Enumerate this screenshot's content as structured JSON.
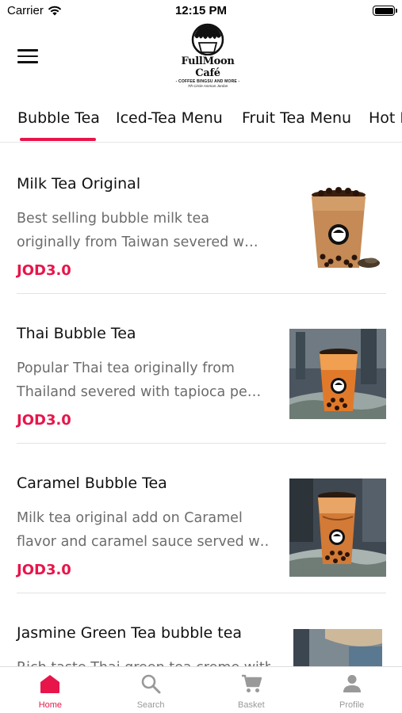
{
  "status_bar": {
    "carrier": "Carrier",
    "time": "12:15 PM"
  },
  "header": {
    "logo_name": "FullMoon Café",
    "logo_tagline": "- COFFEE BINGSU AND MORE -",
    "logo_address": "7th Circle Amman Jordan"
  },
  "tabs": [
    {
      "label": "Bubble Tea",
      "active": true
    },
    {
      "label": "Iced-Tea Menu",
      "active": false
    },
    {
      "label": "Fruit Tea Menu",
      "active": false
    },
    {
      "label": "Hot Dr",
      "active": false
    }
  ],
  "items": [
    {
      "name": "Milk Tea Original",
      "desc_line1": "Best selling bubble milk tea",
      "desc_line2": "originally from Taiwan severed w…",
      "price": "JOD3.0",
      "photo": "milk-tea-original-photo"
    },
    {
      "name": "Thai Bubble Tea",
      "desc_line1": "Popular Thai tea originally from",
      "desc_line2": "Thailand severed with tapioca pe…",
      "price": "JOD3.0",
      "photo": "thai-bubble-tea-photo"
    },
    {
      "name": "Caramel Bubble Tea",
      "desc_line1": "Milk tea original add on Caramel",
      "desc_line2": "flavor and caramel sauce served w…",
      "price": "JOD3.0",
      "photo": "caramel-bubble-tea-photo"
    },
    {
      "name": "Jasmine Green Tea bubble tea",
      "desc_line1": "Rich taste Thai green tea creme with",
      "desc_line2": "",
      "price": "",
      "photo": "jasmine-green-tea-photo"
    }
  ],
  "bottom_nav": [
    {
      "label": "Home",
      "icon": "home-icon",
      "active": true
    },
    {
      "label": "Search",
      "icon": "search-icon",
      "active": false
    },
    {
      "label": "Basket",
      "icon": "cart-icon",
      "active": false
    },
    {
      "label": "Profile",
      "icon": "profile-icon",
      "active": false
    }
  ],
  "colors": {
    "accent": "#e8154a",
    "text_primary": "#111111",
    "text_secondary": "#6c6c6c",
    "nav_inactive": "#999999"
  }
}
